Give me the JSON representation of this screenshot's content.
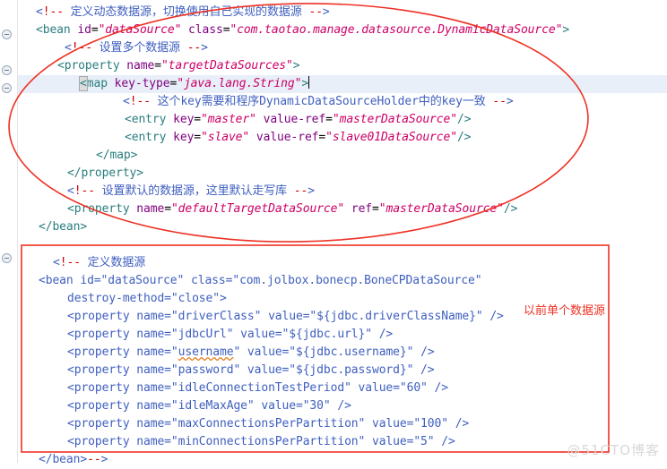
{
  "editor": {
    "language": "xml",
    "current_line_index": 4,
    "gutter": {
      "fold_marker_glyph": "⊖",
      "fold_marker_rows": [
        1,
        3,
        4,
        14
      ]
    },
    "lines": [
      {
        "indent": 4,
        "text": "<!-- 定义动态数据源，切换使用自己实现的数据源 -->"
      },
      {
        "indent": 4,
        "text": "<bean id=\"dataSource\" class=\"com.taotao.manage.datasource.DynamicDataSource\">"
      },
      {
        "indent": 8,
        "text": "<!-- 设置多个数据源 -->"
      },
      {
        "indent": 8,
        "text": "<property name=\"targetDataSources\">"
      },
      {
        "indent": 12,
        "text": "<map key-type=\"java.lang.String\">"
      },
      {
        "indent": 16,
        "text": "<!-- 这个key需要和程序DynamicDataSourceHolder中的key一致 -->"
      },
      {
        "indent": 16,
        "text": "<entry key=\"master\" value-ref=\"masterDataSource\"/>"
      },
      {
        "indent": 16,
        "text": "<entry key=\"slave\" value-ref=\"slave01DataSource\"/>"
      },
      {
        "indent": 12,
        "text": "</map>"
      },
      {
        "indent": 8,
        "text": "</property>"
      },
      {
        "indent": 8,
        "text": "<!-- 设置默认的数据源，这里默认走写库 -->"
      },
      {
        "indent": 8,
        "text": "<property name=\"defaultTargetDataSource\" ref=\"masterDataSource\"/>"
      },
      {
        "indent": 4,
        "text": "</bean>"
      },
      {
        "indent": 0,
        "text": ""
      },
      {
        "indent": 4,
        "text": "<!-- 定义数据源"
      },
      {
        "indent": 4,
        "text": "<bean id=\"dataSource\" class=\"com.jolbox.bonecp.BoneCPDataSource\""
      },
      {
        "indent": 8,
        "text": "destroy-method=\"close\">"
      },
      {
        "indent": 8,
        "text": "<property name=\"driverClass\" value=\"${jdbc.driverClassName}\" />"
      },
      {
        "indent": 8,
        "text": "<property name=\"jdbcUrl\" value=\"${jdbc.url}\" />"
      },
      {
        "indent": 8,
        "text": "<property name=\"username\" value=\"${jdbc.username}\" />"
      },
      {
        "indent": 8,
        "text": "<property name=\"password\" value=\"${jdbc.password}\" />"
      },
      {
        "indent": 8,
        "text": "<property name=\"idleConnectionTestPeriod\" value=\"60\" />"
      },
      {
        "indent": 8,
        "text": "<property name=\"idleMaxAge\" value=\"30\" />"
      },
      {
        "indent": 8,
        "text": "<property name=\"maxConnectionsPerPartition\" value=\"100\" />"
      },
      {
        "indent": 8,
        "text": "<property name=\"minConnectionsPerPartition\" value=\"5\" />"
      },
      {
        "indent": 4,
        "text": "</bean>-->"
      }
    ]
  },
  "annotations": {
    "ellipse_label": "dynamic-datasource-highlight-ellipse",
    "rectangle_label": "legacy-datasource-highlight-rectangle",
    "note_text": "以前单个数据源",
    "accent_color": "#ee3124"
  },
  "watermark": {
    "text": "@51CTO博客",
    "color": "#d8d8d8"
  },
  "colors": {
    "tag": "#2a7d7d",
    "attribute": "#7f007f",
    "attribute_value": "#cc0066",
    "comment": "#3f5fbf",
    "comment_delimiter": "#cc0000",
    "current_line_bg": "#e8eff9",
    "spell_underline": "#e08020"
  }
}
